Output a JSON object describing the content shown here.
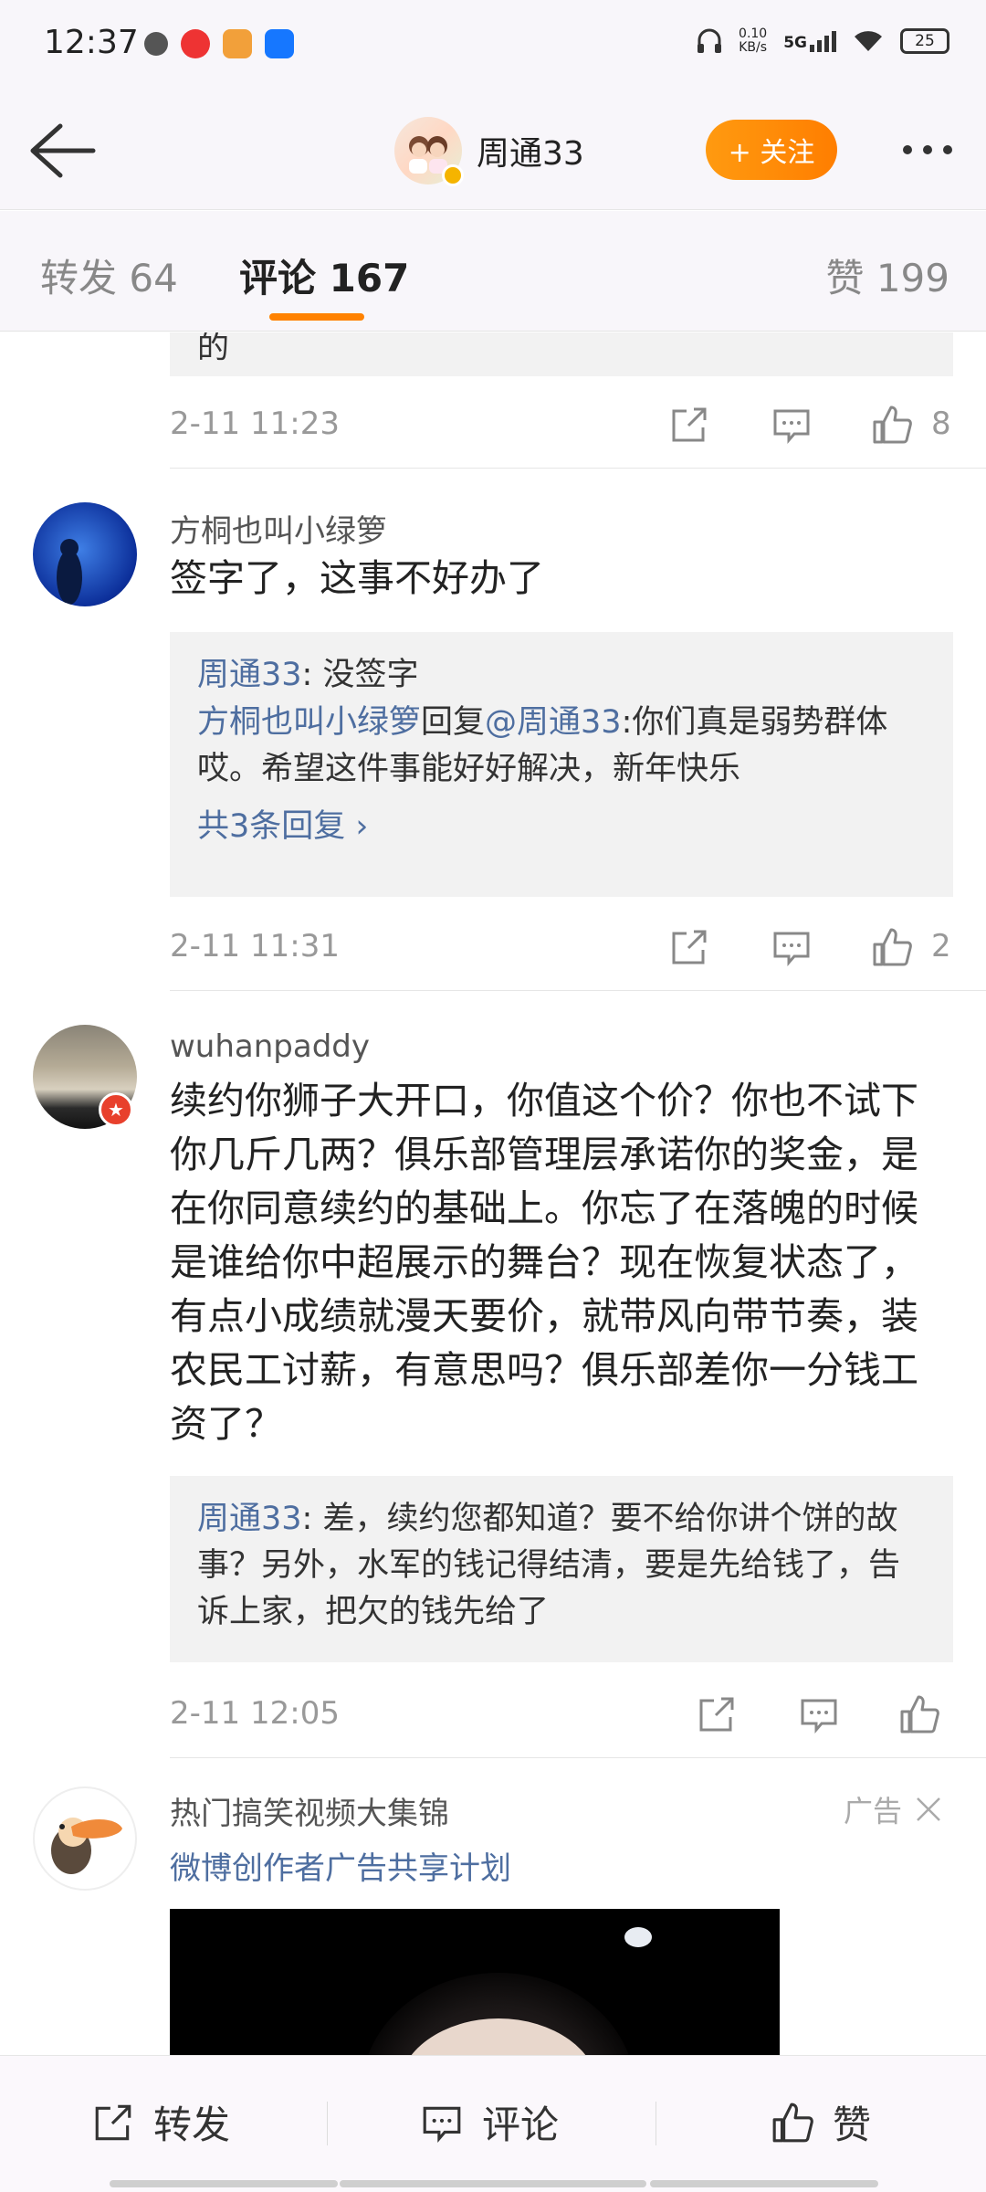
{
  "status_bar": {
    "time": "12:37",
    "net_speed": "0.10\nKB/s",
    "network": "5G",
    "battery": "25"
  },
  "header": {
    "user_name": "周通33",
    "follow_label": "+ 关注"
  },
  "tabs": {
    "repost": "转发 64",
    "comment": "评论 167",
    "like": "赞 199"
  },
  "comments": [
    {
      "partial_text": "的",
      "time": "2-11 11:23",
      "likes": "8"
    },
    {
      "user": "方桐也叫小绿箩",
      "text": "签字了，这事不好办了",
      "replies": [
        {
          "user": "周通33",
          "sep": ": ",
          "text": "没签字"
        },
        {
          "user": "方桐也叫小绿箩",
          "mid": "回复",
          "mention": "@周通33",
          "text": ":你们真是弱势群体 哎。希望这件事能好好解决，新年快乐"
        }
      ],
      "more_replies": "共3条回复 ›",
      "time": "2-11 11:31",
      "likes": "2"
    },
    {
      "user": "wuhanpaddy",
      "text": "续约你狮子大开口，你值这个价？你也不试下你几斤几两？俱乐部管理层承诺你的奖金，是在你同意续约的基础上。你忘了在落魄的时候是谁给你中超展示的舞台？现在恢复状态了，有点小成绩就漫天要价，就带风向带节奏，装农民工讨薪，有意思吗？俱乐部差你一分钱工资了？",
      "reply_user": "周通33",
      "reply_text": ": 差，续约您都知道？要不给你讲个饼的故事？另外，水军的钱记得结清，要是先给钱了，告诉上家，把欠的钱先给了",
      "time": "2-11 12:05"
    }
  ],
  "ad": {
    "title": "热门搞笑视频大集锦",
    "subtitle": "微博创作者广告共享计划",
    "label": "广告"
  },
  "bottom_bar": {
    "repost": "转发",
    "comment": "评论",
    "like": "赞"
  }
}
